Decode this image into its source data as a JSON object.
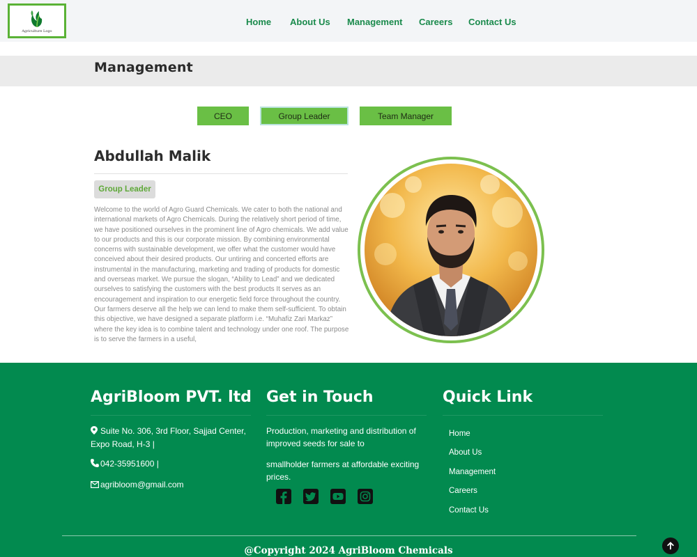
{
  "header": {
    "logo_text": "Agriculture Logo",
    "nav": [
      "Home",
      "About Us",
      "Management",
      "Careers",
      "Contact Us"
    ]
  },
  "page": {
    "title": "Management"
  },
  "tabs": {
    "items": [
      "CEO",
      "Group Leader",
      "Team Manager"
    ],
    "active": "Group Leader"
  },
  "profile": {
    "name": "Abdullah Malik",
    "role": "Group Leader",
    "bio": "Welcome to the world of Agro Guard Chemicals. We cater to both the national and international markets of Agro Chemicals. During the relatively short period of time, we have positioned ourselves in the prominent line of Agro chemicals. We add value to our products and this is our corporate mission. By combining environmental concerns with sustainable development, we offer what the customer would have conceived about their desired products. Our untiring and concerted efforts are instrumental in the manufacturing, marketing and trading of products for domestic and overseas market. We pursue the slogan, “Ability to Lead” and we dedicated ourselves to satisfying the customers with the best products It serves as an encouragement and inspiration to our energetic field force throughout the country. Our farmers deserve all the help we can lend to make them self-sufficient. To obtain this objective, we have designed a separate platform i.e. “Muhafiz Zari Markaz” where the key idea is to combine talent and technology under one roof. The purpose is to serve the farmers in a useful,"
  },
  "footer": {
    "company": {
      "heading": "AgriBloom PVT. ltd",
      "address": "Suite No. 306, 3rd Floor, Sajjad Center, Expo Road, H-3 |",
      "phone": "042-35951600 |",
      "email": "agribloom@gmail.com"
    },
    "contact": {
      "heading": "Get in Touch",
      "text1": "Production, marketing and distribution of improved seeds for sale to",
      "text2": "smallholder farmers at affordable exciting prices.",
      "social_icons": [
        "facebook-icon",
        "twitter-icon",
        "youtube-icon",
        "instagram-icon"
      ]
    },
    "links": {
      "heading": "Quick Link",
      "items": [
        "Home",
        "About Us",
        "Management",
        "Careers",
        "Contact Us"
      ]
    },
    "copyright": "@Copyright 2024 AgriBloom Chemicals"
  },
  "colors": {
    "brand_green": "#028a4f",
    "accent_green": "#6abf45",
    "nav_green": "#1a8a4c"
  }
}
